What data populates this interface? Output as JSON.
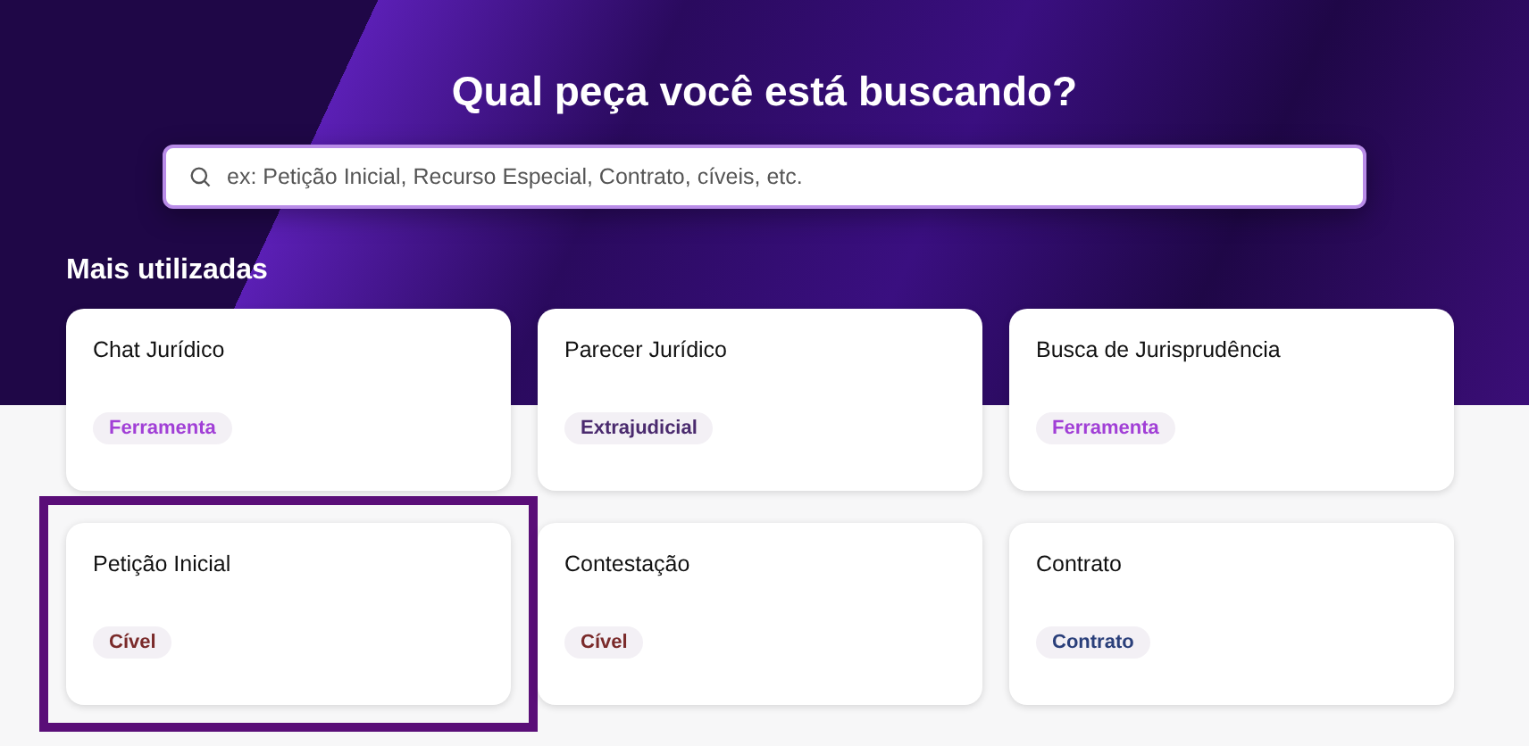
{
  "hero": {
    "title": "Qual peça você está buscando?",
    "search": {
      "placeholder": "ex: Petição Inicial, Recurso Especial, Contrato, cíveis, etc."
    }
  },
  "section": {
    "title": "Mais utilizadas"
  },
  "cards": [
    {
      "title": "Chat Jurídico",
      "tag": "Ferramenta",
      "color": "#a13fd6",
      "selected": false
    },
    {
      "title": "Parecer Jurídico",
      "tag": "Extrajudicial",
      "color": "#4a2a6e",
      "selected": false
    },
    {
      "title": "Busca de Jurisprudência",
      "tag": "Ferramenta",
      "color": "#a13fd6",
      "selected": false
    },
    {
      "title": "Petição Inicial",
      "tag": "Cível",
      "color": "#7a2a2a",
      "selected": true
    },
    {
      "title": "Contestação",
      "tag": "Cível",
      "color": "#7a2a2a",
      "selected": false
    },
    {
      "title": "Contrato",
      "tag": "Contrato",
      "color": "#2a3f7a",
      "selected": false
    }
  ]
}
